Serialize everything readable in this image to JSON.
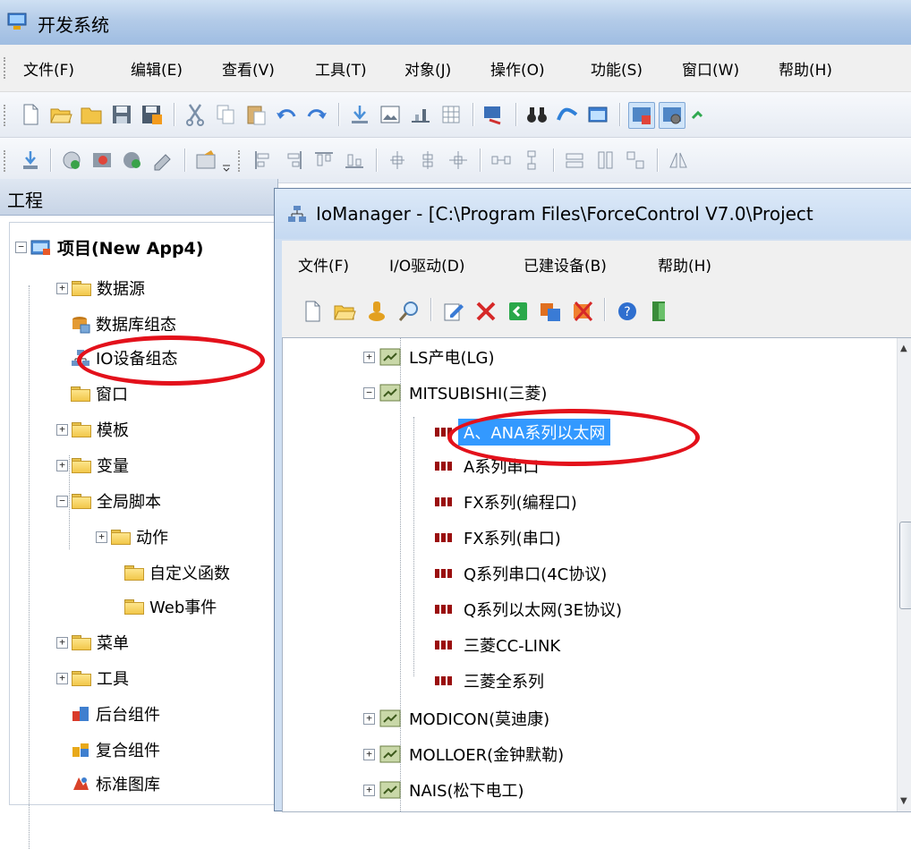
{
  "window": {
    "title": "开发系统"
  },
  "menubar": [
    "文件(F)",
    "编辑(E)",
    "查看(V)",
    "工具(T)",
    "对象(J)",
    "操作(O)",
    "功能(S)",
    "窗口(W)",
    "帮助(H)"
  ],
  "project_pane": {
    "header": "工程",
    "root": "项目(New App4)",
    "items": [
      "数据源",
      "数据库组态",
      "IO设备组态",
      "窗口",
      "模板",
      "变量",
      "全局脚本",
      "动作",
      "自定义函数",
      "Web事件",
      "菜单",
      "工具",
      "后台组件",
      "复合组件",
      "标准图库"
    ]
  },
  "iomanager": {
    "title": "IoManager - [C:\\Program Files\\ForceControl V7.0\\Project",
    "menu": [
      "文件(F)",
      "I/O驱动(D)",
      "已建设备(B)",
      "帮助(H)"
    ],
    "tree": {
      "vendors_top": [
        "LS产电(LG)",
        "MITSUBISHI(三菱)"
      ],
      "drivers": [
        "A、ANA系列以太网",
        "A系列串口",
        "FX系列(编程口)",
        "FX系列(串口)",
        "Q系列串口(4C协议)",
        "Q系列以太网(3E协议)",
        "三菱CC-LINK",
        "三菱全系列"
      ],
      "vendors_bottom": [
        "MODICON(莫迪康)",
        "MOLLOER(金钟默勒)",
        "NAIS(松下电工)"
      ]
    },
    "selected_driver": "A、ANA系列以太网"
  },
  "colors": {
    "highlight": "#3399ff",
    "annotation_ring": "#e3111b"
  }
}
